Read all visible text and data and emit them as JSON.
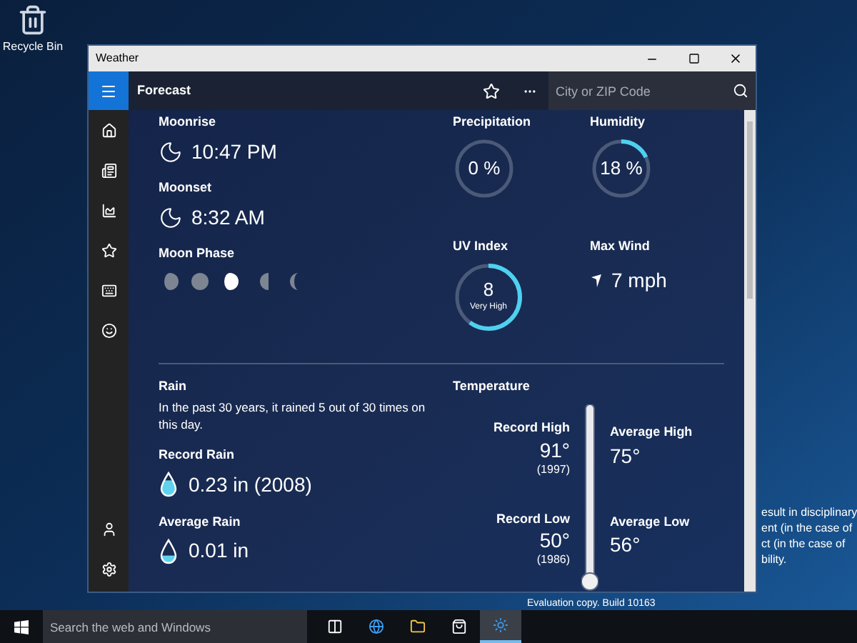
{
  "desktop": {
    "icons": [
      {
        "label": "Recycle Bin"
      }
    ],
    "notice_lines": [
      "esult in disciplinary",
      "ent (in the case of",
      "ct (in the case of",
      "bility."
    ],
    "build_text": "Evaluation copy. Build 10163"
  },
  "window": {
    "title": "Weather"
  },
  "header": {
    "title": "Forecast",
    "search": {
      "placeholder": "City or ZIP Code"
    }
  },
  "sidebar": {
    "items": [
      {
        "kind": "home"
      },
      {
        "kind": "news"
      },
      {
        "kind": "chart"
      },
      {
        "kind": "star"
      },
      {
        "kind": "calendar"
      },
      {
        "kind": "smile"
      }
    ],
    "bottom_items": [
      {
        "kind": "user"
      },
      {
        "kind": "settings"
      }
    ]
  },
  "moon": {
    "times": [
      {
        "label": "Moonrise",
        "value": "10:47 PM"
      },
      {
        "label": "Moonset",
        "value": "8:32 AM"
      }
    ],
    "phase_label": "Moon Phase",
    "phases": [
      {
        "kind": "gibbous",
        "selected": false
      },
      {
        "kind": "full",
        "selected": false
      },
      {
        "kind": "gibbous",
        "selected": true
      },
      {
        "kind": "half",
        "selected": false
      },
      {
        "kind": "crescent",
        "selected": false
      }
    ]
  },
  "gauges": [
    {
      "kind": "ring",
      "label": "Precipitation",
      "value": "0 %",
      "level": 0
    },
    {
      "kind": "ring",
      "label": "Humidity",
      "value": "18 %",
      "level": 0.18
    },
    {
      "kind": "ring",
      "label": "UV Index",
      "value": "8",
      "caption": "Very High",
      "level": 0.6
    },
    {
      "kind": "wind",
      "label": "Max Wind",
      "value": "7 mph"
    }
  ],
  "rain": {
    "title": "Rain",
    "description": "In the past 30 years, it rained 5 out of 30 times on this day.",
    "stats": [
      {
        "label": "Record Rain",
        "value": "0.23 in (2008)",
        "level": 0.7
      },
      {
        "label": "Average Rain",
        "value": "0.01 in",
        "level": 0.3
      }
    ]
  },
  "temperature": {
    "title": "Temperature",
    "record_high": {
      "label": "Record High",
      "value": "91°",
      "year": "(1997)"
    },
    "record_low": {
      "label": "Record Low",
      "value": "50°",
      "year": "(1986)"
    },
    "average_high": {
      "label": "Average High",
      "value": "75°"
    },
    "average_low": {
      "label": "Average Low",
      "value": "56°"
    }
  },
  "taskbar": {
    "search": {
      "placeholder": "Search the web and Windows"
    },
    "apps": [
      {
        "kind": "task-view",
        "selected": false
      },
      {
        "kind": "browser",
        "selected": false
      },
      {
        "kind": "folder",
        "selected": false
      },
      {
        "kind": "store",
        "selected": false
      },
      {
        "kind": "weather",
        "selected": true
      }
    ]
  }
}
